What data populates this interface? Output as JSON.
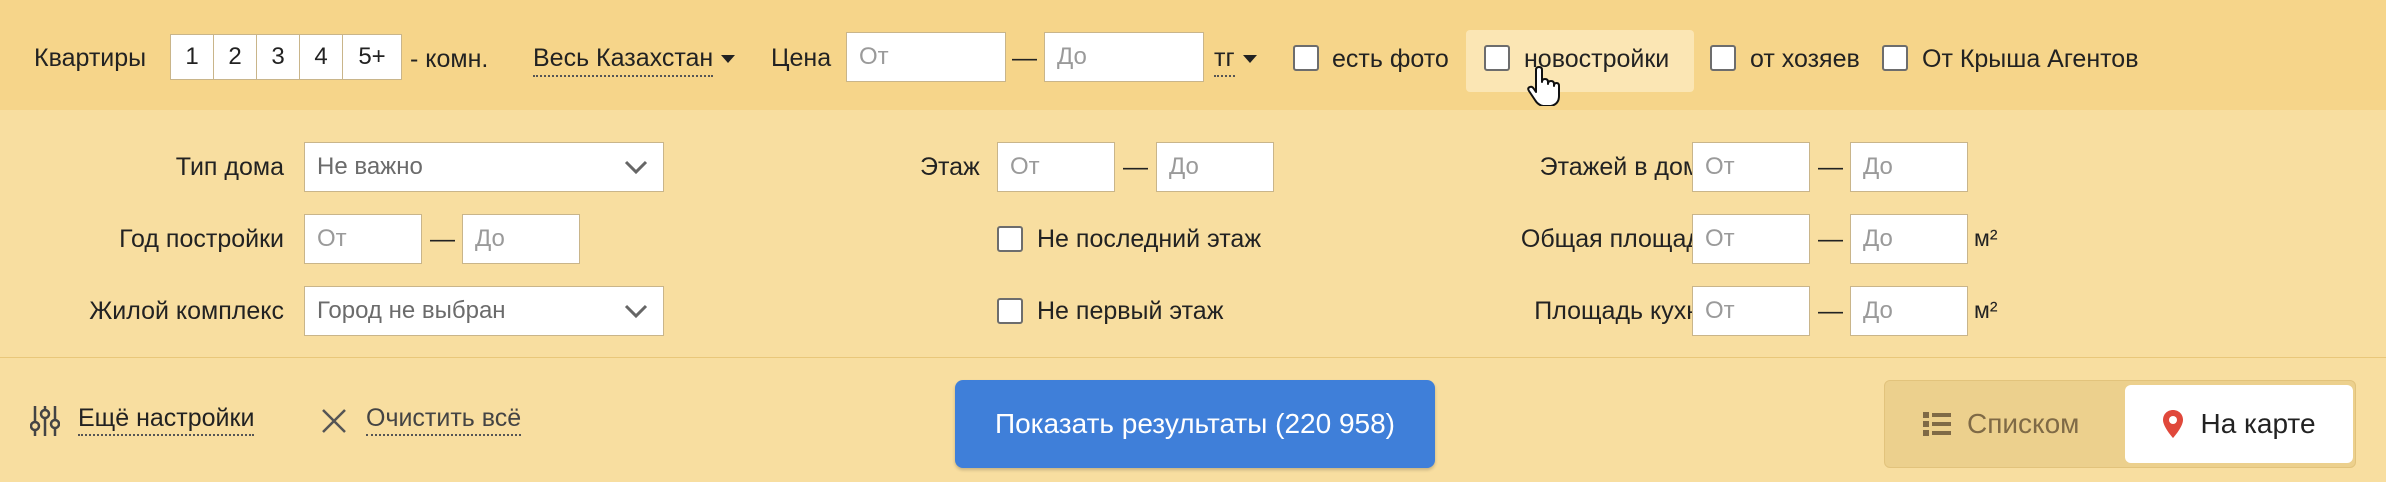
{
  "topbar": {
    "category": "Квартиры",
    "rooms": [
      "1",
      "2",
      "3",
      "4",
      "5+"
    ],
    "rooms_suffix": "- комн.",
    "region": "Весь Казахстан",
    "price_label": "Цена",
    "price_from_placeholder": "От",
    "price_dash": "—",
    "price_to_placeholder": "До",
    "currency": "тг",
    "checkbox_photo": "есть фото",
    "checkbox_new": "новостройки",
    "checkbox_owners": "от хозяев",
    "checkbox_agents": "От Крыша Агентов"
  },
  "filters": {
    "house_type_label": "Тип дома",
    "house_type_value": "Не важно",
    "build_year_label": "Год постройки",
    "build_year_from": "От",
    "build_year_to": "До",
    "complex_label": "Жилой комплекс",
    "complex_value": "Город не выбран",
    "floor_label": "Этаж",
    "floor_from": "От",
    "floor_to": "До",
    "not_last_floor": "Не последний этаж",
    "not_first_floor": "Не первый этаж",
    "floors_in_house_label": "Этажей в доме",
    "floors_from": "От",
    "floors_to": "До",
    "total_area_label": "Общая площадь",
    "total_area_from": "От",
    "total_area_to": "До",
    "kitchen_area_label": "Площадь кухни",
    "kitchen_area_from": "От",
    "kitchen_area_to": "До",
    "unit": "м²",
    "dash": "—"
  },
  "bottombar": {
    "more_settings": "Ещё настройки",
    "clear_all": "Очистить всё",
    "show_results": "Показать результаты (220 958)",
    "view_list": "Списком",
    "view_map": "На карте"
  },
  "colors": {
    "topbar_bg": "#f6d58a",
    "filters_bg": "#f8dea0",
    "button_blue": "#3f7fd9",
    "map_pin_red": "#e0483b"
  },
  "icons": {
    "sliders": "sliders-icon",
    "close": "close-icon",
    "list": "list-icon",
    "map_pin": "map-pin-icon",
    "cursor": "hand-cursor-icon"
  }
}
